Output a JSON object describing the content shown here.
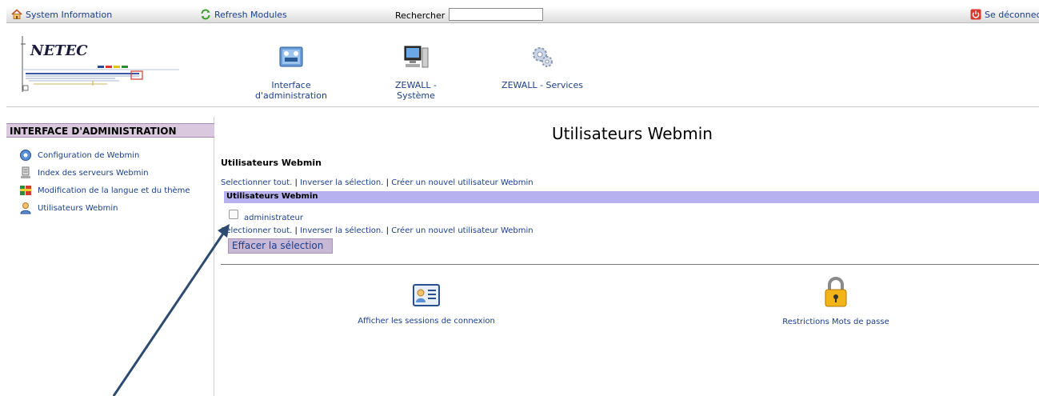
{
  "topbar": {
    "system_info": "System Information",
    "refresh": "Refresh Modules",
    "search_label": "Rechercher :",
    "search_value": "",
    "logout": "Se déconnecte"
  },
  "header": {
    "logo_text": "NETEC",
    "modules": [
      {
        "label": "Interface d'administration",
        "icon": "admin-interface-icon"
      },
      {
        "label": "ZEWALL - Système",
        "icon": "computer-icon"
      },
      {
        "label": "ZEWALL - Services",
        "icon": "gears-icon"
      }
    ]
  },
  "sidebar": {
    "title": "INTERFACE D'ADMINISTRATION",
    "items": [
      {
        "label": "Configuration de Webmin",
        "icon": "webmin-config-icon"
      },
      {
        "label": "Index des serveurs Webmin",
        "icon": "server-index-icon"
      },
      {
        "label": "Modification de la langue et du thème",
        "icon": "language-theme-icon"
      },
      {
        "label": "Utilisateurs Webmin",
        "icon": "users-icon"
      }
    ]
  },
  "main": {
    "title": "Utilisateurs Webmin",
    "subtitle": "Utilisateurs Webmin",
    "links": {
      "select_all": "Selectionner tout.",
      "invert": "Inverser la sélection.",
      "create": "Créer un nouvel utilisateur Webmin"
    },
    "table_header": "Utilisateurs Webmin",
    "users": [
      {
        "name": "administrateur",
        "checked": false
      }
    ],
    "clear_button": "Effacer la sélection",
    "actions": [
      {
        "label": "Afficher les sessions de connexion",
        "icon": "sessions-icon"
      },
      {
        "label": "Restrictions Mots de passe",
        "icon": "padlock-icon"
      }
    ]
  },
  "colors": {
    "link": "#1a3f8a",
    "sidebar_title_bg": "#d9c8de",
    "table_header_bg": "#b7b1f0",
    "button_bg": "#c9b7d6",
    "annotation_arrow": "#2d4a70"
  }
}
